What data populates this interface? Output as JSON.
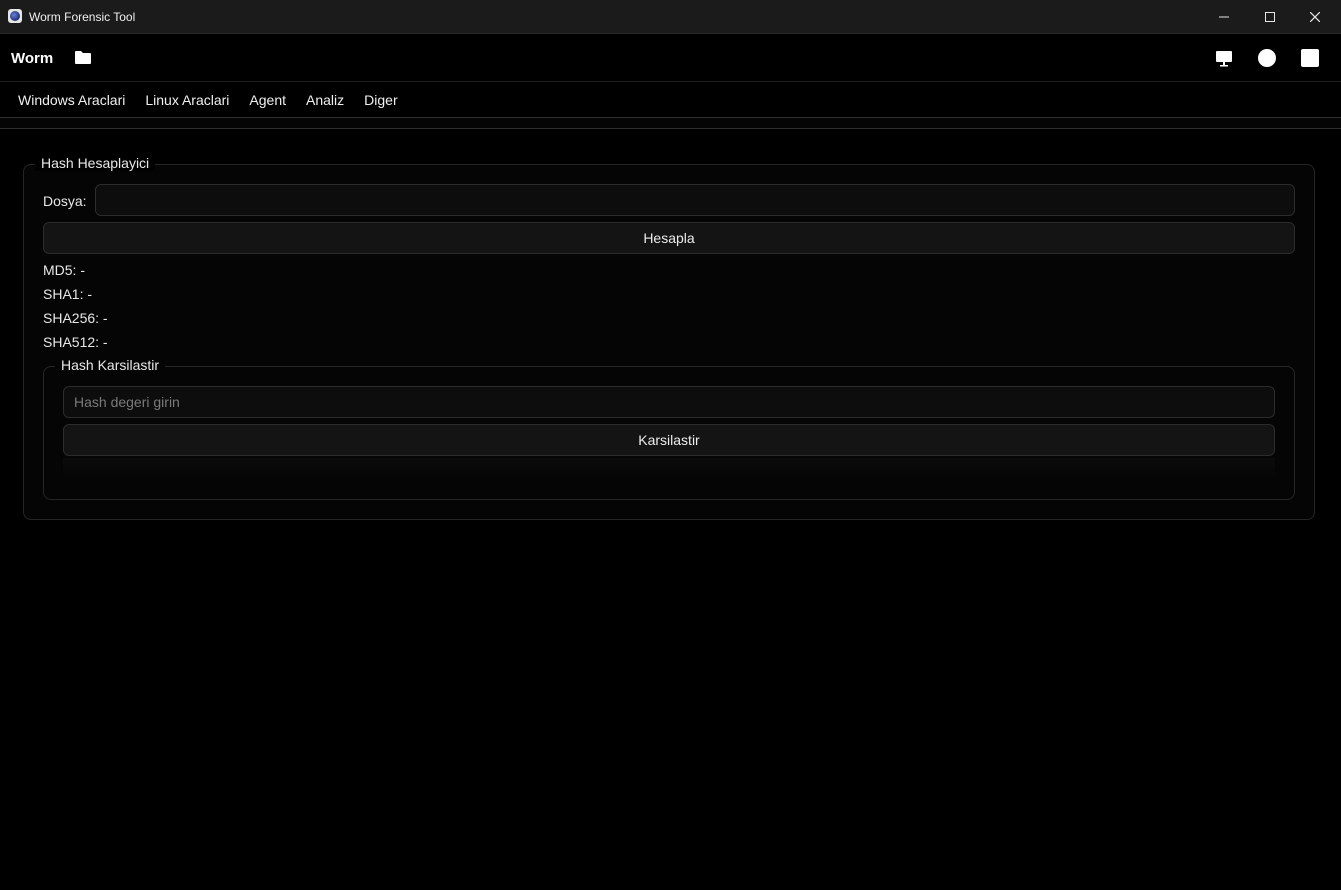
{
  "window": {
    "title": "Worm Forensic Tool"
  },
  "toolbar": {
    "brand": "Worm",
    "icons": [
      "folder-icon",
      "monitor-icon",
      "circle-icon",
      "square-icon"
    ]
  },
  "menu": {
    "items": [
      "Windows Araclari",
      "Linux Araclari",
      "Agent",
      "Analiz",
      "Diger"
    ]
  },
  "hash_calc": {
    "title": "Hash Hesaplayici",
    "file_label": "Dosya:",
    "file_value": "",
    "calc_button": "Hesapla",
    "md5": "MD5: -",
    "sha1": "SHA1: -",
    "sha256": "SHA256: -",
    "sha512": "SHA512: -"
  },
  "hash_compare": {
    "title": "Hash Karsilastir",
    "placeholder": "Hash degeri girin",
    "compare_button": "Karsilastir"
  },
  "colors": {
    "background": "#000000",
    "titlebar": "#1b1b1b",
    "border": "#2c2c2c",
    "text": "#e8e8e8"
  }
}
